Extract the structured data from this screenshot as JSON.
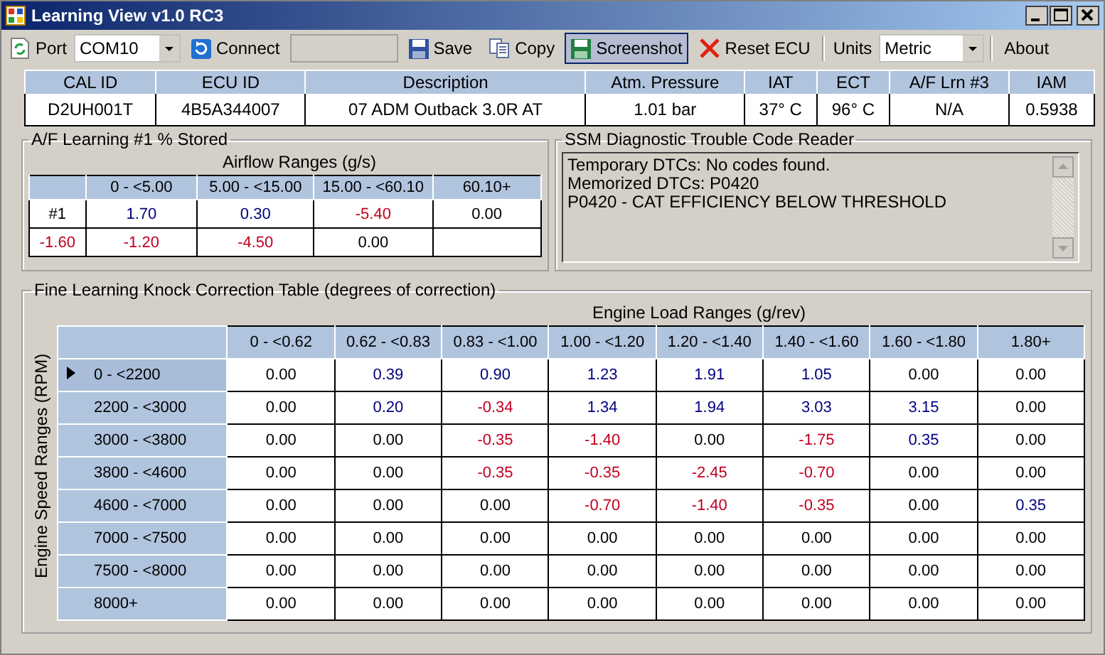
{
  "window": {
    "title": "Learning View v1.0 RC3"
  },
  "toolbar": [
    {
      "kind": "label",
      "text": "Port"
    },
    {
      "kind": "combo",
      "value": "COM10"
    },
    {
      "kind": "button",
      "text": "Connect",
      "pressed": false
    },
    {
      "kind": "field"
    },
    {
      "kind": "button",
      "text": "Save",
      "pressed": false
    },
    {
      "kind": "button",
      "text": "Copy",
      "pressed": false
    },
    {
      "kind": "button",
      "text": "Screenshot",
      "pressed": true
    },
    {
      "kind": "button",
      "text": "Reset ECU",
      "pressed": false
    },
    {
      "kind": "label",
      "text": "Units"
    },
    {
      "kind": "combo",
      "value": "Metric"
    },
    {
      "kind": "button",
      "text": "About",
      "pressed": false
    }
  ],
  "info_table": {
    "columns": [
      "CAL ID",
      "ECU ID",
      "Description",
      "Atm. Pressure",
      "IAT",
      "ECT",
      "A/F Lrn #3",
      "IAM"
    ],
    "row": [
      "D2UH001T",
      "4B5A344007",
      "07 ADM Outback 3.0R AT",
      "1.01 bar",
      "37° C",
      "96° C",
      "N/A",
      "0.5938"
    ]
  },
  "af_learning": {
    "title": "A/F Learning #1 % Stored",
    "caption": "Airflow Ranges (g/s)",
    "columns": [
      "",
      "0 - <5.00",
      "5.00 - <15.00",
      "15.00 - <60.10",
      "60.10+"
    ],
    "rows": [
      [
        {
          "text": "#1",
          "color": "#000000"
        },
        {
          "text": "1.70",
          "color": "#000080"
        },
        {
          "text": "0.30",
          "color": "#000080"
        },
        {
          "text": "-5.40",
          "color": "#c00020"
        },
        {
          "text": "0.00",
          "color": "#000000"
        }
      ],
      [
        {
          "text": "-1.60",
          "color": "#c00020"
        },
        {
          "text": "-1.20",
          "color": "#c00020"
        },
        {
          "text": "-4.50",
          "color": "#c00020"
        },
        {
          "text": "0.00",
          "color": "#000000"
        },
        {
          "text": "",
          "color": "#000000"
        }
      ]
    ]
  },
  "dtc_reader": {
    "title": "SSM Diagnostic Trouble Code Reader",
    "lines": [
      "Temporary DTCs: No codes found.",
      "Memorized DTCs: P0420",
      "P0420 - CAT EFFICIENCY BELOW THRESHOLD"
    ]
  },
  "knock_table": {
    "title": "Fine Learning Knock Correction Table (degrees of correction)",
    "caption": "Engine Load Ranges (g/rev)",
    "row_axis": "Engine Speed Ranges (RPM)",
    "columns": [
      "0 - <0.62",
      "0.62 - <0.83",
      "0.83 - <1.00",
      "1.00 - <1.20",
      "1.20 - <1.40",
      "1.40 - <1.60",
      "1.60 - <1.80",
      "1.80+"
    ],
    "rows": [
      {
        "label": "0 - <2200",
        "selected": true,
        "cells": [
          {
            "text": "0.00",
            "color": "#000000"
          },
          {
            "text": "0.39",
            "color": "#000080"
          },
          {
            "text": "0.90",
            "color": "#000080"
          },
          {
            "text": "1.23",
            "color": "#000080"
          },
          {
            "text": "1.91",
            "color": "#000080"
          },
          {
            "text": "1.05",
            "color": "#000080"
          },
          {
            "text": "0.00",
            "color": "#000000"
          },
          {
            "text": "0.00",
            "color": "#000000"
          }
        ]
      },
      {
        "label": "2200 - <3000",
        "selected": false,
        "cells": [
          {
            "text": "0.00",
            "color": "#000000"
          },
          {
            "text": "0.20",
            "color": "#000080"
          },
          {
            "text": "-0.34",
            "color": "#c00020"
          },
          {
            "text": "1.34",
            "color": "#000080"
          },
          {
            "text": "1.94",
            "color": "#000080"
          },
          {
            "text": "3.03",
            "color": "#000080"
          },
          {
            "text": "3.15",
            "color": "#000080"
          },
          {
            "text": "0.00",
            "color": "#000000"
          }
        ]
      },
      {
        "label": "3000 - <3800",
        "selected": false,
        "cells": [
          {
            "text": "0.00",
            "color": "#000000"
          },
          {
            "text": "0.00",
            "color": "#000000"
          },
          {
            "text": "-0.35",
            "color": "#c00020"
          },
          {
            "text": "-1.40",
            "color": "#c00020"
          },
          {
            "text": "0.00",
            "color": "#000000"
          },
          {
            "text": "-1.75",
            "color": "#c00020"
          },
          {
            "text": "0.35",
            "color": "#000080"
          },
          {
            "text": "0.00",
            "color": "#000000"
          }
        ]
      },
      {
        "label": "3800 - <4600",
        "selected": false,
        "cells": [
          {
            "text": "0.00",
            "color": "#000000"
          },
          {
            "text": "0.00",
            "color": "#000000"
          },
          {
            "text": "-0.35",
            "color": "#c00020"
          },
          {
            "text": "-0.35",
            "color": "#c00020"
          },
          {
            "text": "-2.45",
            "color": "#c00020"
          },
          {
            "text": "-0.70",
            "color": "#c00020"
          },
          {
            "text": "0.00",
            "color": "#000000"
          },
          {
            "text": "0.00",
            "color": "#000000"
          }
        ]
      },
      {
        "label": "4600 - <7000",
        "selected": false,
        "cells": [
          {
            "text": "0.00",
            "color": "#000000"
          },
          {
            "text": "0.00",
            "color": "#000000"
          },
          {
            "text": "0.00",
            "color": "#000000"
          },
          {
            "text": "-0.70",
            "color": "#c00020"
          },
          {
            "text": "-1.40",
            "color": "#c00020"
          },
          {
            "text": "-0.35",
            "color": "#c00020"
          },
          {
            "text": "0.00",
            "color": "#000000"
          },
          {
            "text": "0.35",
            "color": "#000080"
          }
        ]
      },
      {
        "label": "7000 - <7500",
        "selected": false,
        "cells": [
          {
            "text": "0.00",
            "color": "#000000"
          },
          {
            "text": "0.00",
            "color": "#000000"
          },
          {
            "text": "0.00",
            "color": "#000000"
          },
          {
            "text": "0.00",
            "color": "#000000"
          },
          {
            "text": "0.00",
            "color": "#000000"
          },
          {
            "text": "0.00",
            "color": "#000000"
          },
          {
            "text": "0.00",
            "color": "#000000"
          },
          {
            "text": "0.00",
            "color": "#000000"
          }
        ]
      },
      {
        "label": "7500 - <8000",
        "selected": false,
        "cells": [
          {
            "text": "0.00",
            "color": "#000000"
          },
          {
            "text": "0.00",
            "color": "#000000"
          },
          {
            "text": "0.00",
            "color": "#000000"
          },
          {
            "text": "0.00",
            "color": "#000000"
          },
          {
            "text": "0.00",
            "color": "#000000"
          },
          {
            "text": "0.00",
            "color": "#000000"
          },
          {
            "text": "0.00",
            "color": "#000000"
          },
          {
            "text": "0.00",
            "color": "#000000"
          }
        ]
      },
      {
        "label": "8000+",
        "selected": false,
        "cells": [
          {
            "text": "0.00",
            "color": "#000000"
          },
          {
            "text": "0.00",
            "color": "#000000"
          },
          {
            "text": "0.00",
            "color": "#000000"
          },
          {
            "text": "0.00",
            "color": "#000000"
          },
          {
            "text": "0.00",
            "color": "#000000"
          },
          {
            "text": "0.00",
            "color": "#000000"
          },
          {
            "text": "0.00",
            "color": "#000000"
          },
          {
            "text": "0.00",
            "color": "#000000"
          }
        ]
      }
    ]
  }
}
